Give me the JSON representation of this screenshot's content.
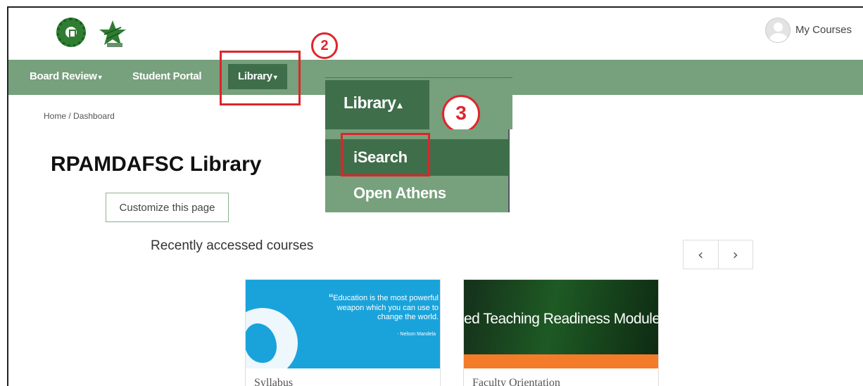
{
  "header": {
    "my_courses": "My Courses"
  },
  "nav": {
    "items": [
      {
        "label": "Board Review",
        "caret": "▾"
      },
      {
        "label": "Student Portal"
      },
      {
        "label": "Library",
        "caret": "▾"
      }
    ]
  },
  "annotations": [
    "2",
    "3"
  ],
  "dropdown": {
    "title": "Library",
    "caret": "▴",
    "items": [
      "iSearch",
      "Open Athens"
    ]
  },
  "breadcrumb": {
    "home": "Home",
    "separator": "/",
    "current": "Dashboard"
  },
  "page": {
    "title": "RPAMDAFSC Library",
    "customize_button": "Customize this page"
  },
  "recent": {
    "title": "Recently accessed courses",
    "prev": "‹",
    "next": "›",
    "courses": [
      {
        "quote": "Education is the most powerful weapon which you can use to change the world.",
        "quote_mark": "“",
        "author": "- Nelson Mandela",
        "name": "Syllabus"
      },
      {
        "banner": "ed Teaching Readiness Module",
        "name": "Faculty Orientation"
      }
    ]
  },
  "colors": {
    "nav_bg": "#77a07c",
    "nav_active": "#3f6e4a",
    "annotation": "#e0242b"
  }
}
